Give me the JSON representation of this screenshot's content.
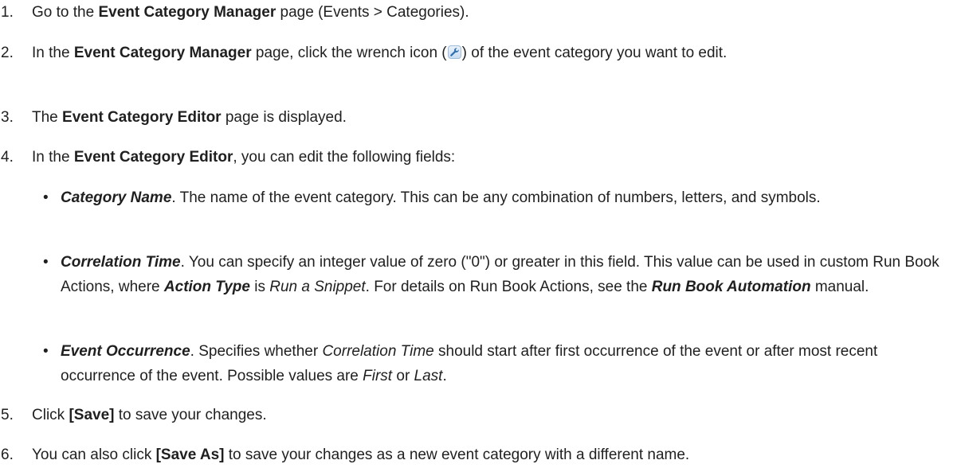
{
  "steps": [
    {
      "number": "1.",
      "parts": [
        "Go to the ",
        "Event Category Manager",
        " page (Events > Categories)."
      ]
    },
    {
      "number": "2.",
      "parts": [
        "In the ",
        "Event Category Manager",
        " page, click the wrench icon (",
        ") of the event category you want to edit."
      ],
      "icon": "wrench-icon"
    },
    {
      "number": "3.",
      "parts": [
        "The ",
        "Event Category Editor",
        " page is displayed."
      ]
    },
    {
      "number": "4.",
      "parts": [
        "In the ",
        "Event Category Editor",
        ", you can edit the following fields:"
      ],
      "fields": [
        {
          "name": "Category Name",
          "text": ". The name of the event category. This can be any combination of numbers, letters, and symbols."
        },
        {
          "name": "Correlation Time",
          "text1": ". You can specify an integer value of zero (\"0\") or greater in this field. This value can be used in custom Run Book Actions, where ",
          "emph1": "Action Type",
          "text2": " is ",
          "emph2": "Run a Snippet",
          "text3": ". For details on Run Book Actions, see the ",
          "emph3": "Run Book Automation",
          "text4": " manual."
        },
        {
          "name": "Event Occurrence",
          "text1": ". Specifies whether ",
          "emph1": "Correlation Time",
          "text2": " should start after first occurrence of the event or after most recent occurrence of the event. Possible values are ",
          "emph2": "First",
          "text3": " or ",
          "emph3": "Last",
          "text4": "."
        }
      ]
    },
    {
      "number": "5.",
      "parts": [
        "Click ",
        "[Save]",
        " to save your changes."
      ]
    },
    {
      "number": "6.",
      "parts": [
        "You can also click ",
        "[Save As]",
        " to save your changes as a new event category with a different name."
      ]
    }
  ],
  "bullet_char": "•",
  "colors": {
    "text": "#1f1f1f",
    "icon_bg": "#c9ddf2",
    "icon_fg": "#2f6fb0"
  }
}
